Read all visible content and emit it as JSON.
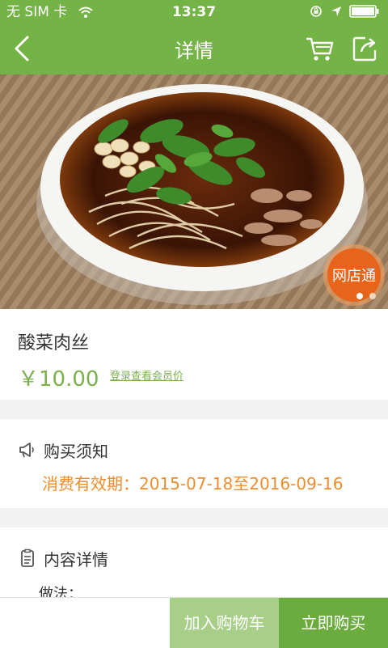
{
  "status_bar": {
    "carrier": "无 SIM 卡",
    "time": "13:37",
    "icons": [
      "wifi-icon",
      "rotation-lock-icon",
      "location-arrow-icon",
      "battery-icon"
    ]
  },
  "nav": {
    "title": "详情",
    "back_icon": "chevron-left-icon",
    "cart_icon": "cart-icon",
    "share_icon": "share-icon"
  },
  "hero": {
    "badge_text": "网店通",
    "carousel_dots": 2,
    "active_dot": 0
  },
  "product": {
    "name": "酸菜肉丝",
    "price": "￥10.00",
    "member_link": "登录查看会员价"
  },
  "notice": {
    "title": "购买须知",
    "text": "消费有效期：2015-07-18至2016-09-16"
  },
  "detail": {
    "title": "内容详情",
    "method_label": "做法："
  },
  "bottom_bar": {
    "add_to_cart": "加入购物车",
    "buy_now": "立即购买"
  },
  "colors": {
    "brand_green": "#74b346",
    "price_green": "#7ab04e",
    "notice_orange": "#f08c2a",
    "badge_orange": "#e8641a",
    "cart_button": "#a7cf88",
    "buy_button": "#6aad3e"
  }
}
